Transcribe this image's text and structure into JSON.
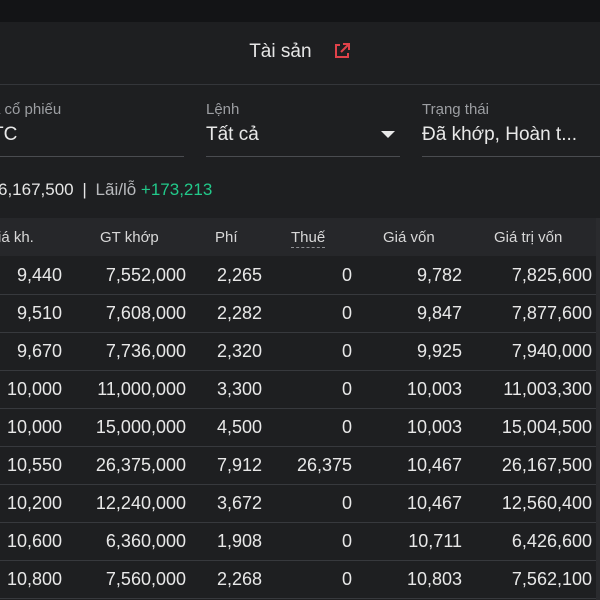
{
  "header": {
    "title": "Tài sản",
    "icon": "external-link-icon",
    "icon_color": "#e0424a"
  },
  "filters": {
    "stock": {
      "label": "ã cổ phiếu",
      "value": "TC"
    },
    "order": {
      "label": "Lệnh",
      "value": "Tất cả"
    },
    "status": {
      "label": "Trạng thái",
      "value": "Đã khớp, Hoàn t..."
    }
  },
  "summary": {
    "total": "6,167,500",
    "separator": "|",
    "pl_label": "Lãi/lỗ",
    "pl_value": "+173,213",
    "pl_color": "#22c98a"
  },
  "table": {
    "columns": [
      "iá kh.",
      "GT khớp",
      "Phí",
      "Thuế",
      "Giá vốn",
      "Giá trị vốn"
    ],
    "rows": [
      [
        "9,440",
        "7,552,000",
        "2,265",
        "0",
        "9,782",
        "7,825,600"
      ],
      [
        "9,510",
        "7,608,000",
        "2,282",
        "0",
        "9,847",
        "7,877,600"
      ],
      [
        "9,670",
        "7,736,000",
        "2,320",
        "0",
        "9,925",
        "7,940,000"
      ],
      [
        "10,000",
        "11,000,000",
        "3,300",
        "0",
        "10,003",
        "11,003,300"
      ],
      [
        "10,000",
        "15,000,000",
        "4,500",
        "0",
        "10,003",
        "15,004,500"
      ],
      [
        "10,550",
        "26,375,000",
        "7,912",
        "26,375",
        "10,467",
        "26,167,500"
      ],
      [
        "10,200",
        "12,240,000",
        "3,672",
        "0",
        "10,467",
        "12,560,400"
      ],
      [
        "10,600",
        "6,360,000",
        "1,908",
        "0",
        "10,711",
        "6,426,600"
      ],
      [
        "10,800",
        "7,560,000",
        "2,268",
        "0",
        "10,803",
        "7,562,100"
      ]
    ]
  }
}
